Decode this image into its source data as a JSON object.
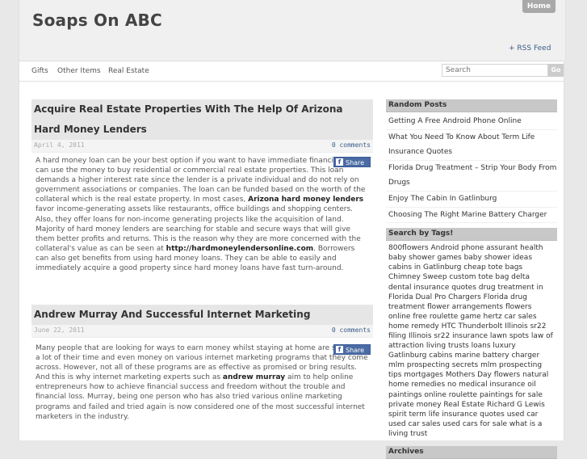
{
  "site": {
    "title": "Soaps On ABC",
    "home_label": "Home",
    "rss_label": "+ RSS Feed"
  },
  "nav": {
    "items": [
      "Gifts",
      "Other Items",
      "Real Estate"
    ]
  },
  "search": {
    "placeholder": "Search",
    "button_label": "Go"
  },
  "posts": [
    {
      "title": "Acquire Real Estate Properties With The Help Of Arizona Hard Money Lenders",
      "date": "April 4, 2011",
      "comments": "0 comments",
      "share_label": "Share",
      "body": {
        "p1": "A hard money loan can be your best option if you want to have immediate financing. You can use the money to buy residential or commercial real estate properties. This loan demands a higher interest rate since the lender is a private individual and do not rely on government associations or companies. The loan can be funded based on the worth of the collateral which is the real estate property. In most cases, ",
        "link1": "Arizona hard money lenders",
        "p2": " favor income-generating assets like restaurants, office buildings and shopping centers. Also, they offer loans for non-income generating projects like the acquisition of land. Majority of hard money lenders are searching for stable and secure ways that will give them better profits and returns. This is the reason why they are more concerned with the collateral's value as can be seen at ",
        "link2": "http://hardmoneylendersonline.com",
        "p3": ". Borrowers can also get benefits from using hard money loans. They can be able to easily and immediately acquire a good property since hard money loans have fast turn-around."
      }
    },
    {
      "title": "Andrew Murray And Successful Internet Marketing",
      "date": "June 22, 2011",
      "comments": "0 comments",
      "share_label": "Share",
      "body": {
        "p1": "Many people that are looking for ways to earn money whilst staying at home are spending a lot of their time and even money on various internet marketing programs that they come across. However, not all of these programs are as effective as promised or bring results. And this is why internet marketing experts such as ",
        "link1": "andrew murray",
        "p2": " aim to help online entrepreneurs how to achieve financial success and freedom without the trouble and financial loss. Murray, being one person who has also tried various online marketing programs and failed and tried again is now considered one of the most successful internet marketers in the industry."
      }
    }
  ],
  "sidebar": {
    "random_title": "Random Posts",
    "random_posts": [
      "Getting A Free Android Phone Online",
      "What You Need To Know About Term Life Insurance Quotes",
      "Florida Drug Treatment – Strip Your Body From Drugs",
      "Enjoy The Cabin In Gatlinburg",
      "Choosing The Right Marine Battery Charger"
    ],
    "tags_title": "Search by Tags!",
    "tags": "800flowers Android phone assurant health baby shower games baby shower ideas cabins in Gatlinburg cheap tote bags Chimney Sweep custom tote bag delta dental insurance quotes drug treatment in Florida Dual Pro Chargers Florida drug treatment flower arrangements flowers online free roulette game hertz car sales home remedy HTC Thunderbolt Illinois sr22 filing Illinois sr22 insurance lawn spots law of attraction living trusts loans luxury Gatlinburg cabins marine battery charger mlm prospecting secrets mlm prospecting tips mortgages Mothers Day flowers natural home remedies no medical insurance oil paintings online roulette paintings for sale private money Real Estate Richard G Lewis spirit term life insurance quotes used car used car sales used cars for sale what is a living trust",
    "archives_title": "Archives"
  }
}
